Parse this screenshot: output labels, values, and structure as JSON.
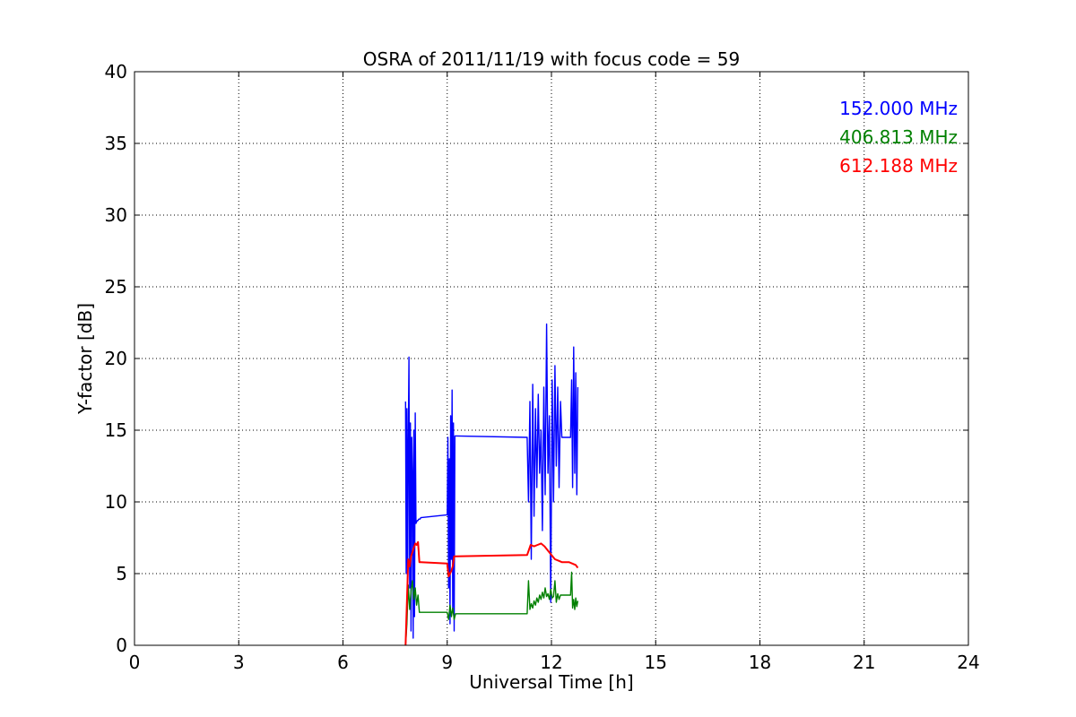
{
  "chart_data": {
    "type": "line",
    "title": "OSRA of 2011/11/19 with focus code = 59",
    "xlabel": "Universal Time [h]",
    "ylabel": "Y-factor [dB]",
    "xlim": [
      0,
      24
    ],
    "ylim": [
      0,
      40
    ],
    "xticks": [
      0,
      3,
      6,
      9,
      12,
      15,
      18,
      21,
      24
    ],
    "yticks": [
      0,
      5,
      10,
      15,
      20,
      25,
      30,
      35,
      40
    ],
    "grid": true,
    "legend_position": "top-right",
    "series": [
      {
        "name": "152.000 MHz",
        "color": "#0000ff",
        "x": [
          7.8,
          7.82,
          7.84,
          7.86,
          7.88,
          7.9,
          7.92,
          7.94,
          7.96,
          7.98,
          8.0,
          8.02,
          8.04,
          8.06,
          8.08,
          8.1,
          8.12,
          8.14,
          8.16,
          8.18,
          8.2,
          8.22,
          8.24,
          9.0,
          9.02,
          9.04,
          9.06,
          9.08,
          9.1,
          9.12,
          9.14,
          9.16,
          9.18,
          9.2,
          9.22,
          9.24,
          9.26,
          11.3,
          11.34,
          11.38,
          11.42,
          11.46,
          11.5,
          11.54,
          11.58,
          11.62,
          11.66,
          11.7,
          11.74,
          11.78,
          11.82,
          11.86,
          11.9,
          11.94,
          11.98,
          12.02,
          12.06,
          12.1,
          12.14,
          12.18,
          12.22,
          12.26,
          12.3,
          12.55,
          12.58,
          12.61,
          12.64,
          12.67,
          12.7,
          12.73,
          12.76
        ],
        "y": [
          17.0,
          5.0,
          16.5,
          3.5,
          14.0,
          20.1,
          4.0,
          15.5,
          1.0,
          14.5,
          12.0,
          0.5,
          15.0,
          2.0,
          16.2,
          8.5,
          8.6,
          8.7,
          8.7,
          8.8,
          8.8,
          8.8,
          8.9,
          9.1,
          14.5,
          4.0,
          13.0,
          1.5,
          16.0,
          6.0,
          17.8,
          2.5,
          15.5,
          1.0,
          14.6,
          14.6,
          14.6,
          14.5,
          10.0,
          17.0,
          6.0,
          18.2,
          9.0,
          16.5,
          11.0,
          17.5,
          12.0,
          15.0,
          8.0,
          18.0,
          10.5,
          22.4,
          12.0,
          16.0,
          3.0,
          18.5,
          10.0,
          19.5,
          12.5,
          18.0,
          11.0,
          17.0,
          14.5,
          14.5,
          18.5,
          11.0,
          20.8,
          12.0,
          19.0,
          10.5,
          18.0
        ]
      },
      {
        "name": "406.813 MHz",
        "color": "#008000",
        "x": [
          7.8,
          7.84,
          7.88,
          7.92,
          7.96,
          8.0,
          8.04,
          8.08,
          8.12,
          8.16,
          8.2,
          8.24,
          9.0,
          9.04,
          9.08,
          9.12,
          9.16,
          9.2,
          9.24,
          11.3,
          11.34,
          11.38,
          11.42,
          11.46,
          11.5,
          11.54,
          11.58,
          11.62,
          11.66,
          11.7,
          11.74,
          11.78,
          11.82,
          11.86,
          11.9,
          11.94,
          11.98,
          12.02,
          12.06,
          12.1,
          12.14,
          12.18,
          12.22,
          12.26,
          12.3,
          12.55,
          12.58,
          12.61,
          12.64,
          12.67,
          12.7,
          12.73,
          12.76
        ],
        "y": [
          0.0,
          1.5,
          4.2,
          2.5,
          3.8,
          4.5,
          3.2,
          4.0,
          2.8,
          3.5,
          2.3,
          2.3,
          2.3,
          1.8,
          2.8,
          2.0,
          2.6,
          1.8,
          2.2,
          2.2,
          4.5,
          2.5,
          2.9,
          2.6,
          3.1,
          2.8,
          3.3,
          3.0,
          3.5,
          3.2,
          3.7,
          3.3,
          4.0,
          3.4,
          3.6,
          3.2,
          3.9,
          3.3,
          3.4,
          4.5,
          3.0,
          3.6,
          3.2,
          3.5,
          3.5,
          3.5,
          5.1,
          2.6,
          3.2,
          2.5,
          3.3,
          2.7,
          3.1
        ]
      },
      {
        "name": "612.188 MHz",
        "color": "#ff0000",
        "x": [
          7.8,
          7.84,
          7.88,
          7.92,
          7.96,
          8.0,
          8.04,
          8.08,
          8.12,
          8.16,
          8.2,
          8.24,
          9.0,
          9.04,
          9.08,
          9.12,
          9.16,
          9.2,
          9.24,
          11.3,
          11.4,
          11.5,
          11.6,
          11.7,
          11.8,
          11.9,
          12.0,
          12.1,
          12.2,
          12.3,
          12.4,
          12.5,
          12.6,
          12.7,
          12.76
        ],
        "y": [
          0.0,
          3.0,
          6.0,
          5.5,
          6.2,
          6.5,
          6.8,
          7.1,
          7.0,
          7.2,
          5.8,
          5.8,
          5.7,
          4.8,
          5.0,
          5.2,
          5.5,
          6.2,
          6.2,
          6.3,
          7.0,
          6.9,
          7.0,
          7.1,
          6.9,
          6.6,
          6.3,
          6.0,
          5.9,
          5.8,
          5.8,
          5.8,
          5.7,
          5.6,
          5.4
        ]
      }
    ]
  }
}
